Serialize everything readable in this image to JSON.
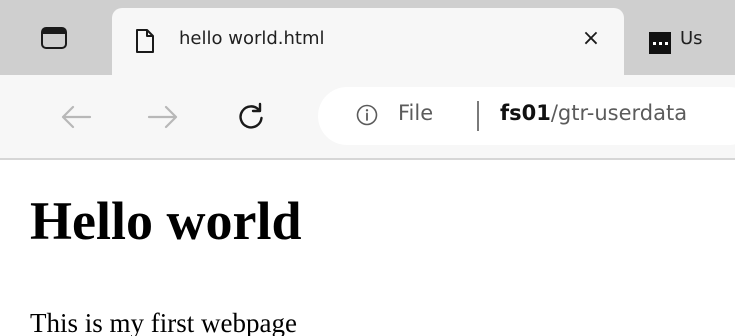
{
  "tabs": {
    "active": {
      "title": "hello world.html",
      "icon": "document-icon",
      "close_label": "×"
    },
    "inactive": {
      "title": "Us",
      "icon": "ellipsis-favicon"
    }
  },
  "toolbar": {
    "back_icon": "arrow-left-icon",
    "forward_icon": "arrow-right-icon",
    "reload_icon": "reload-icon",
    "address": {
      "info_icon": "info-icon",
      "scheme_label": "File",
      "host": "fs01",
      "path": "/gtr-userdata"
    }
  },
  "page": {
    "heading": "Hello world",
    "paragraph": "This is my first webpage"
  },
  "colors": {
    "tabstrip_bg": "#cfcfcf",
    "toolbar_bg": "#f7f7f7",
    "address_bg": "#ffffff",
    "disabled_icon": "#b8b8b8"
  }
}
